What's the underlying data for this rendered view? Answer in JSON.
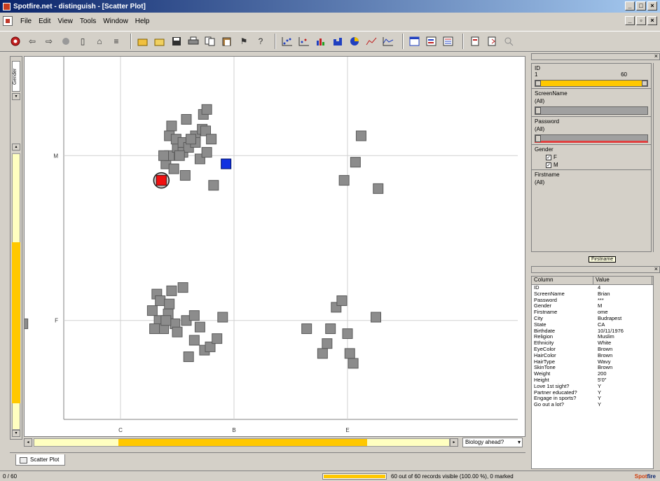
{
  "window": {
    "title": "Spotfire.net - distinguish - [Scatter Plot]",
    "buttons": [
      "minimize",
      "maximize",
      "close"
    ]
  },
  "menu": [
    "File",
    "Edit",
    "View",
    "Tools",
    "Window",
    "Help"
  ],
  "toolbar": {
    "icons": [
      "stop-icon",
      "back-icon",
      "forward-icon",
      "refresh-icon",
      "page-icon",
      "home-icon",
      "list-icon",
      "open-icon",
      "open-folder-icon",
      "save-icon",
      "print-icon",
      "copy-icon",
      "paste-icon",
      "find-icon",
      "help-icon",
      "scatter-icon",
      "3d-scatter-icon",
      "bar-icon",
      "histogram-icon",
      "pie-icon",
      "line-icon",
      "profile-icon",
      "table-icon",
      "filter-icon",
      "details-icon",
      "new-doc-icon",
      "export-icon",
      "magnify-icon"
    ]
  },
  "axis_selector": {
    "label": "Gender"
  },
  "plot": {
    "y_ticks": [
      "M",
      "F"
    ],
    "x_ticks": [
      "C",
      "B",
      "E"
    ],
    "x_axis_combo": "Biology ahead?"
  },
  "chart_data": {
    "type": "scatter",
    "title": "",
    "xlabel": "",
    "ylabel": "",
    "x_categories": [
      "C",
      "B",
      "E"
    ],
    "y_categories": [
      "M",
      "F"
    ],
    "points_gray": [
      [
        0.4,
        0.95
      ],
      [
        0.43,
        1.12
      ],
      [
        0.43,
        1.0
      ],
      [
        0.47,
        0.92
      ],
      [
        0.5,
        1.05
      ],
      [
        0.49,
        1.1
      ],
      [
        0.55,
        1.08
      ],
      [
        0.55,
        1.02
      ],
      [
        0.58,
        1.22
      ],
      [
        0.6,
        1.05
      ],
      [
        0.66,
        1.12
      ],
      [
        0.66,
        1.08
      ],
      [
        0.7,
        0.98
      ],
      [
        0.72,
        1.16
      ],
      [
        0.73,
        1.25
      ],
      [
        0.75,
        1.15
      ],
      [
        0.76,
        1.28
      ],
      [
        0.76,
        1.02
      ],
      [
        0.8,
        1.1
      ],
      [
        0.82,
        0.82
      ],
      [
        0.38,
        1.0
      ],
      [
        0.45,
        1.18
      ],
      [
        0.52,
        1.0
      ],
      [
        0.62,
        1.1
      ],
      [
        0.57,
        0.88
      ],
      [
        -0.97,
        0.94
      ],
      [
        1.97,
        0.85
      ],
      [
        2.07,
        0.96
      ],
      [
        2.12,
        1.12
      ],
      [
        2.27,
        0.8
      ],
      [
        0.32,
        0.16
      ],
      [
        0.35,
        0.12
      ],
      [
        0.43,
        0.1
      ],
      [
        0.45,
        0.18
      ],
      [
        0.55,
        0.2
      ],
      [
        0.42,
        0.04
      ],
      [
        0.34,
        0.0
      ],
      [
        0.38,
        -0.05
      ],
      [
        0.48,
        -0.02
      ],
      [
        0.4,
        0.0
      ],
      [
        0.28,
        0.06
      ],
      [
        0.3,
        -0.05
      ],
      [
        0.5,
        -0.07
      ],
      [
        0.58,
        0.0
      ],
      [
        0.65,
        0.03
      ],
      [
        0.7,
        -0.04
      ],
      [
        0.65,
        -0.12
      ],
      [
        0.74,
        -0.18
      ],
      [
        0.6,
        -0.22
      ],
      [
        0.79,
        -0.16
      ],
      [
        0.85,
        -0.11
      ],
      [
        0.9,
        0.02
      ],
      [
        -0.86,
        -0.02
      ],
      [
        1.64,
        -0.05
      ],
      [
        1.85,
        -0.05
      ],
      [
        1.9,
        0.08
      ],
      [
        1.95,
        0.12
      ],
      [
        1.82,
        -0.14
      ],
      [
        1.78,
        -0.2
      ],
      [
        2.0,
        -0.08
      ],
      [
        2.02,
        -0.2
      ],
      [
        2.05,
        -0.26
      ],
      [
        2.25,
        0.02
      ]
    ],
    "point_selected_blue": [
      0.93,
      0.95
    ],
    "point_marked_red": [
      0.36,
      0.85
    ],
    "xlim": [
      -1.5,
      2.5
    ],
    "ylim": [
      -0.6,
      1.6
    ],
    "grid": true,
    "legend": "none"
  },
  "tabs": [
    {
      "label": "Scatter Plot"
    }
  ],
  "filters": [
    {
      "name": "ID",
      "min": "1",
      "max": "60",
      "kind": "range"
    },
    {
      "name": "ScreenName",
      "value": "(All)",
      "kind": "text"
    },
    {
      "name": "Password",
      "value": "(All)",
      "kind": "text"
    },
    {
      "name": "Gender",
      "kind": "checkbox",
      "options": [
        {
          "label": "F",
          "checked": true
        },
        {
          "label": "M",
          "checked": true
        }
      ]
    },
    {
      "name": "Firstname",
      "value": "(All)",
      "kind": "text"
    }
  ],
  "tooltip": "Firstname",
  "details": {
    "headers": [
      "Column",
      "Value"
    ],
    "rows": [
      [
        "ID",
        "4"
      ],
      [
        "ScreenName",
        "Brian"
      ],
      [
        "Password",
        "***"
      ],
      [
        "Gender",
        "M"
      ],
      [
        "Firstname",
        "ome"
      ],
      [
        "City",
        "Budrapest"
      ],
      [
        "State",
        "CA"
      ],
      [
        "Birthdate",
        "10/11/1976"
      ],
      [
        "Religion",
        "Muslim"
      ],
      [
        "Ethnicity",
        "White"
      ],
      [
        "EyeColor",
        "Brown"
      ],
      [
        "HairColor",
        "Brown"
      ],
      [
        "HairType",
        "Wavy"
      ],
      [
        "SkinTone",
        "Brown"
      ],
      [
        "Weight",
        "200"
      ],
      [
        "Height",
        "5'0\""
      ],
      [
        "Love 1st sight?",
        "Y"
      ],
      [
        "Partner educated?",
        "Y"
      ],
      [
        "Engage in sports?",
        "Y"
      ],
      [
        "Go out a lot?",
        "Y"
      ]
    ]
  },
  "status": {
    "left": "0 / 60",
    "progress": 1.0,
    "message": "60 out of 60 records visible (100.00 %), 0 marked",
    "logo_a": "Spot",
    "logo_b": "fire"
  }
}
